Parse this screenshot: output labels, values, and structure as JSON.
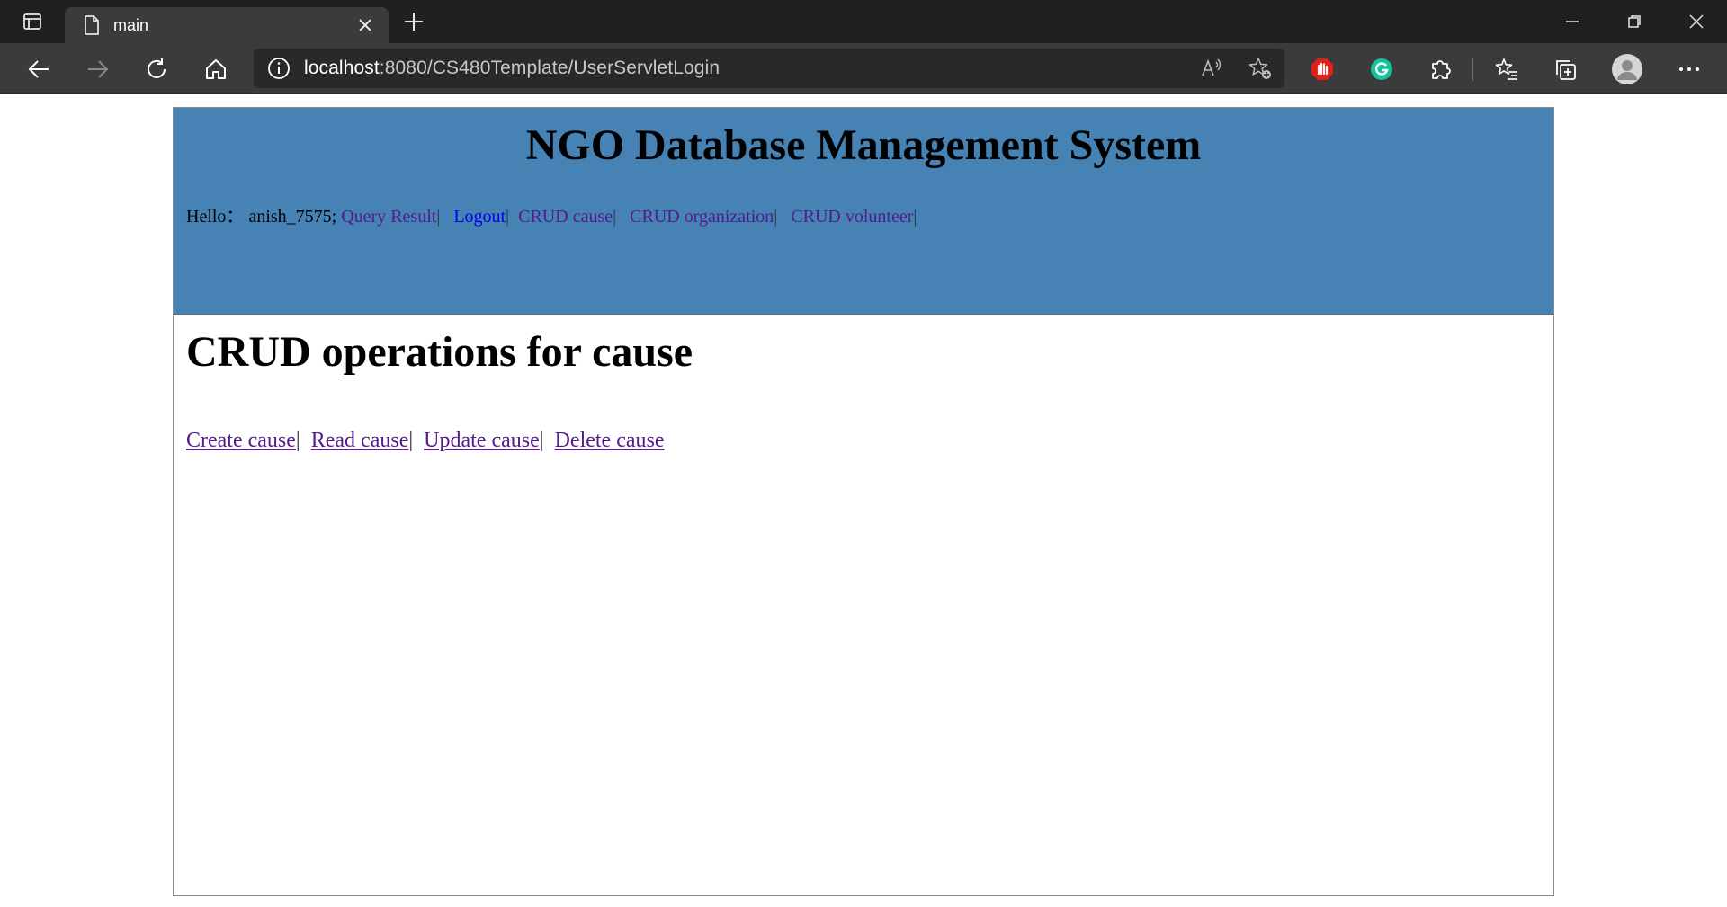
{
  "browser": {
    "tab_title": "main",
    "url_host": "localhost",
    "url_rest": ":8080/CS480Template/UserServletLogin"
  },
  "header": {
    "title": "NGO Database Management System",
    "greeting_prefix": "Hello：",
    "username": "anish_7575;",
    "nav": {
      "query_result": "Query Result",
      "logout": "Logout",
      "crud_cause": "CRUD cause",
      "crud_organization": "CRUD organization",
      "crud_volunteer": "CRUD volunteer",
      "separator": "|"
    }
  },
  "main": {
    "heading": "CRUD operations for cause",
    "links": {
      "create": "Create cause",
      "read": "Read cause",
      "update": "Update cause",
      "delete": "Delete cause",
      "separator": "|"
    }
  },
  "colors": {
    "header_bg": "#4682b4",
    "visited_link": "#551a8b",
    "link": "#0000ee",
    "chrome_dark": "#202020",
    "chrome_toolbar": "#3b3b3b"
  }
}
